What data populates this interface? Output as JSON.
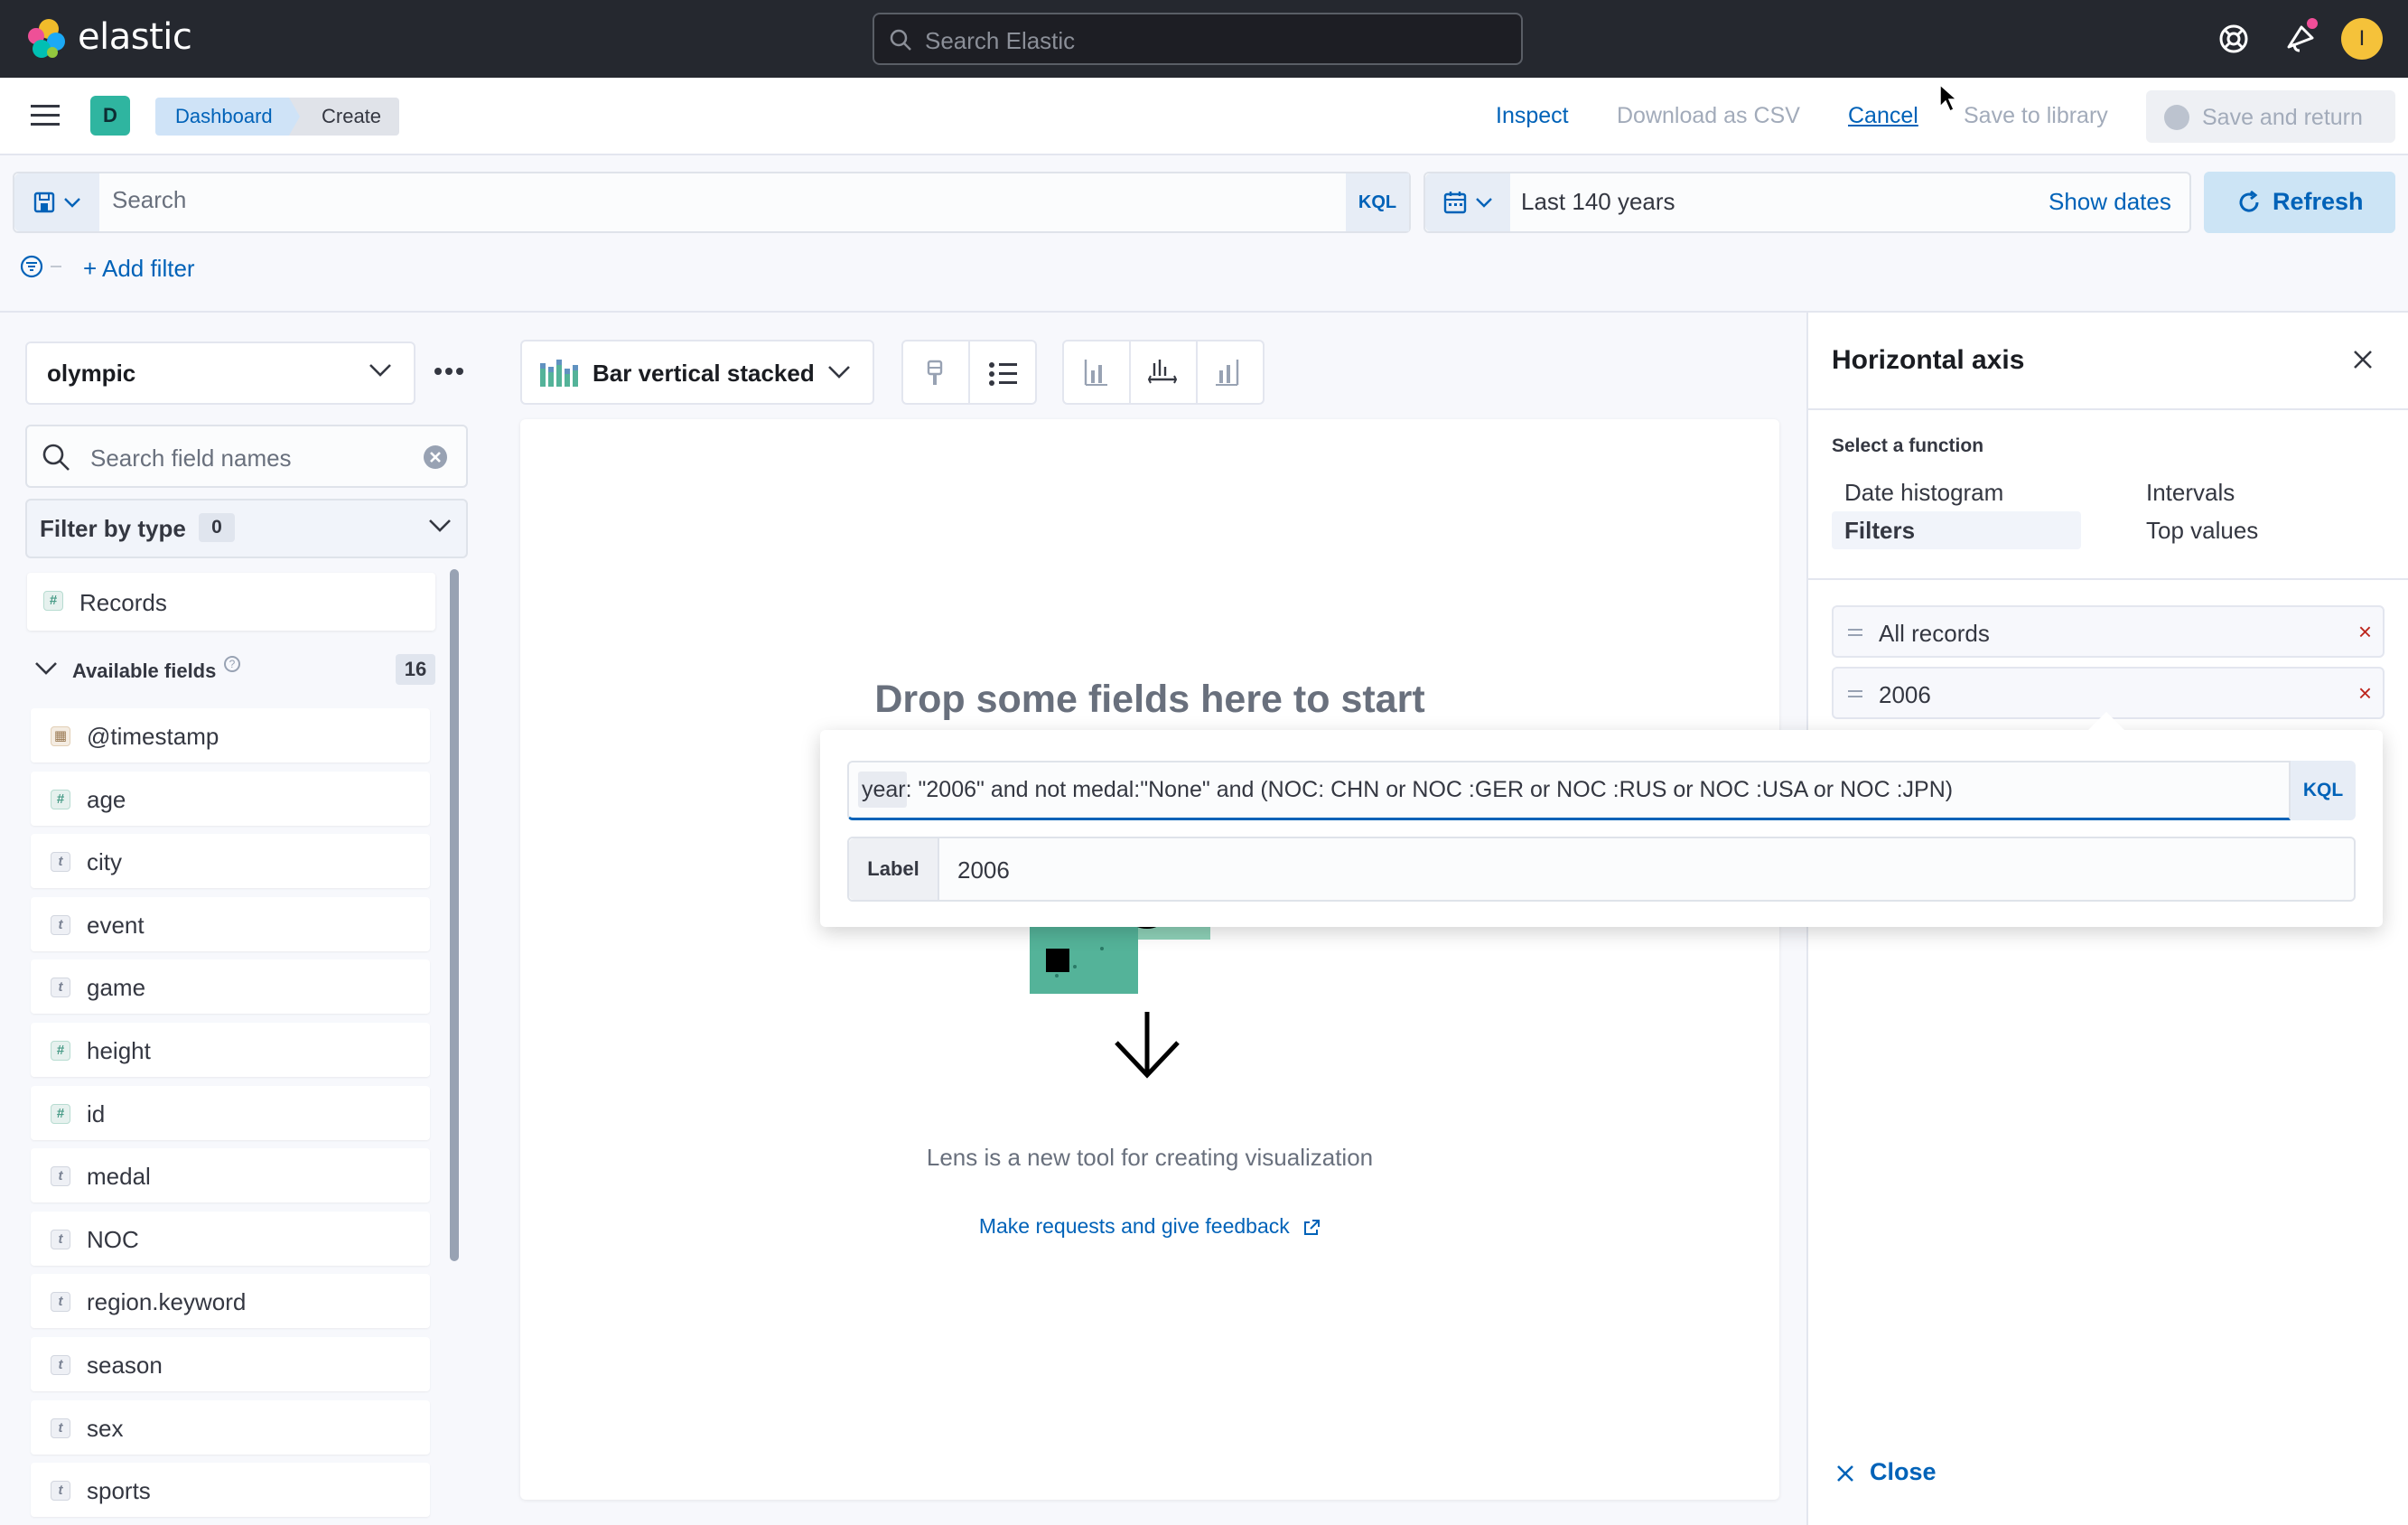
{
  "header": {
    "brand": "elastic",
    "search_placeholder": "Search Elastic",
    "avatar_initial": "I"
  },
  "appbar": {
    "space_initial": "D",
    "breadcrumbs": [
      "Dashboard",
      "Create"
    ],
    "actions": {
      "inspect": "Inspect",
      "download_csv": "Download as CSV",
      "cancel": "Cancel",
      "save_to_library": "Save to library",
      "save_and_return": "Save and return"
    }
  },
  "query_bar": {
    "placeholder": "Search",
    "language": "KQL",
    "date_range": "Last 140 years",
    "show_dates": "Show dates",
    "refresh": "Refresh"
  },
  "filters": {
    "add_filter": "+ Add filter"
  },
  "sidebar": {
    "index_pattern": "olympic",
    "field_search_placeholder": "Search field names",
    "filter_by_type": "Filter by type",
    "filter_by_type_count": "0",
    "records": "Records",
    "available_fields_label": "Available fields",
    "available_fields_count": "16",
    "fields": [
      {
        "name": "@timestamp",
        "type": "date"
      },
      {
        "name": "age",
        "type": "number"
      },
      {
        "name": "city",
        "type": "string"
      },
      {
        "name": "event",
        "type": "string"
      },
      {
        "name": "game",
        "type": "string"
      },
      {
        "name": "height",
        "type": "number"
      },
      {
        "name": "id",
        "type": "number"
      },
      {
        "name": "medal",
        "type": "string"
      },
      {
        "name": "NOC",
        "type": "string"
      },
      {
        "name": "region.keyword",
        "type": "string"
      },
      {
        "name": "season",
        "type": "string"
      },
      {
        "name": "sex",
        "type": "string"
      },
      {
        "name": "sports",
        "type": "string"
      }
    ]
  },
  "workspace": {
    "vis_type": "Bar vertical stacked",
    "drop_title": "Drop some fields here to start",
    "description": "Lens is a new tool for creating visualization",
    "feedback_link": "Make requests and give feedback"
  },
  "flyout": {
    "title": "Horizontal axis",
    "select_function_label": "Select a function",
    "functions": [
      "Date histogram",
      "Intervals",
      "Filters",
      "Top values"
    ],
    "selected_function": "Filters",
    "filter_items": [
      "All records",
      "2006"
    ],
    "query_value": "year: \"2006\"  and not medal:\"None\" and (NOC: CHN or NOC :GER or NOC :RUS or NOC :USA or NOC :JPN)",
    "query_language": "KQL",
    "label_prefix": "Label",
    "label_value": "2006",
    "close": "Close"
  },
  "colors": {
    "accent": "#0062b8",
    "header_bg": "#25282f",
    "space_badge": "#2fb5a0",
    "avatar": "#f5c23a",
    "danger": "#bd271e"
  }
}
